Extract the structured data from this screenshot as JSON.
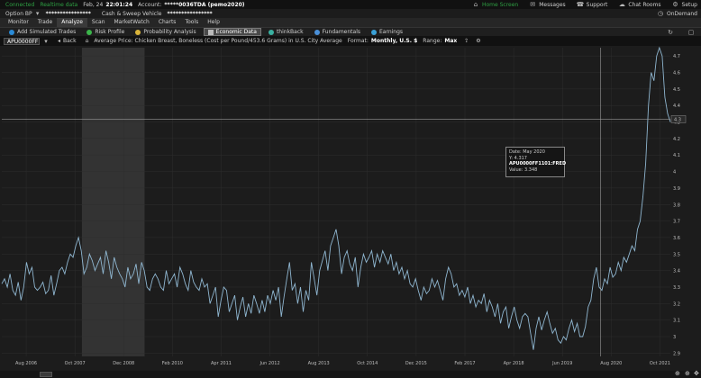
{
  "status_bar": {
    "connection": "Connected",
    "data_mode": "Realtime data",
    "date": "Feb, 24",
    "time": "22:01:24",
    "account_label": "Account:",
    "account_value": "*****0036TDA (pemo2020)",
    "right_items": [
      "Home Screen",
      "Messages",
      "Support",
      "Chat Rooms",
      "Setup"
    ]
  },
  "account_bar": {
    "option_bp_label": "Option BP",
    "option_bp_value": "****************",
    "cash_label": "Cash & Sweep Vehicle",
    "cash_value": "****************",
    "ondemand_label": "OnDemand"
  },
  "menu": {
    "items": [
      "Monitor",
      "Trade",
      "Analyze",
      "Scan",
      "MarketWatch",
      "Charts",
      "Tools",
      "Help"
    ],
    "active": "Analyze"
  },
  "toolbar": {
    "items": [
      {
        "label": "Add Simulated Trades",
        "color": "#2a8ad6"
      },
      {
        "label": "Risk Profile",
        "color": "#3bb54a"
      },
      {
        "label": "Probability Analysis",
        "color": "#d9b43a"
      },
      {
        "label": "Economic Data",
        "color": "#bbbbbb"
      },
      {
        "label": "thinkBack",
        "color": "#3ab0a0"
      },
      {
        "label": "Fundamentals",
        "color": "#4a90d9"
      },
      {
        "label": "Earnings",
        "color": "#3aa0d6"
      }
    ],
    "active": "Economic Data"
  },
  "nav": {
    "symbol": "APU0000FF1101:FRED",
    "back_label": "Back",
    "series_title": "Average Price: Chicken Breast, Boneless (Cost per Pound/453.6 Grams) in U.S. City Average",
    "format_label": "Format:",
    "format_value": "Monthly, U.S. $",
    "range_label": "Range:",
    "range_value": "Max"
  },
  "tooltip": {
    "date_label": "Date:",
    "date_value": "May 2020",
    "y_label": "Y:",
    "y_value": "4.317",
    "series": "APU0000FF1101:FRED",
    "value_label": "Value:",
    "value_value": "3.348"
  },
  "colors": {
    "line": "#8fb6d0",
    "grid": "#2e2e2e",
    "shade": "#333333",
    "crosshair": "#9a9a9a"
  },
  "chart_data": {
    "type": "line",
    "x_tick_labels": [
      "Aug 2006",
      "Oct 2007",
      "Dec 2008",
      "Feb 2010",
      "Apr 2011",
      "Jun 2012",
      "Aug 2013",
      "Oct 2014",
      "Dec 2015",
      "Feb 2017",
      "Apr 2018",
      "Jun 2019",
      "Aug 2020",
      "Oct 2021"
    ],
    "y_tick_labels": [
      "2.9",
      "3",
      "3.1",
      "3.2",
      "3.3",
      "3.4",
      "3.5",
      "3.6",
      "3.7",
      "3.8",
      "3.9",
      "4",
      "4.1",
      "4.2",
      "4.3",
      "4.4",
      "4.5",
      "4.6",
      "4.7"
    ],
    "ylim": [
      2.88,
      4.75
    ],
    "y_axis_top_label": "4.3",
    "recession_shading": [
      "Dec 2007",
      "Jun 2009"
    ],
    "crosshair": {
      "x": "May 2020",
      "y": 4.317
    },
    "start": "2006-01",
    "end": "2022-01",
    "series": [
      {
        "values": [
          3.32,
          3.35,
          3.3,
          3.38,
          3.28,
          3.25,
          3.33,
          3.22,
          3.3,
          3.45,
          3.38,
          3.42,
          3.3,
          3.28,
          3.3,
          3.33,
          3.26,
          3.28,
          3.37,
          3.25,
          3.32,
          3.4,
          3.42,
          3.38,
          3.45,
          3.5,
          3.48,
          3.55,
          3.6,
          3.52,
          3.38,
          3.42,
          3.5,
          3.46,
          3.4,
          3.44,
          3.48,
          3.38,
          3.52,
          3.45,
          3.35,
          3.48,
          3.42,
          3.38,
          3.35,
          3.3,
          3.42,
          3.35,
          3.38,
          3.44,
          3.32,
          3.45,
          3.4,
          3.3,
          3.28,
          3.35,
          3.38,
          3.35,
          3.3,
          3.28,
          3.4,
          3.32,
          3.35,
          3.38,
          3.3,
          3.42,
          3.38,
          3.32,
          3.28,
          3.4,
          3.33,
          3.3,
          3.28,
          3.35,
          3.3,
          3.32,
          3.2,
          3.25,
          3.3,
          3.12,
          3.22,
          3.3,
          3.28,
          3.15,
          3.2,
          3.25,
          3.1,
          3.18,
          3.24,
          3.12,
          3.2,
          3.14,
          3.25,
          3.2,
          3.14,
          3.22,
          3.15,
          3.25,
          3.2,
          3.28,
          3.22,
          3.3,
          3.12,
          3.24,
          3.35,
          3.45,
          3.28,
          3.32,
          3.2,
          3.3,
          3.15,
          3.28,
          3.22,
          3.45,
          3.35,
          3.25,
          3.4,
          3.46,
          3.52,
          3.4,
          3.55,
          3.6,
          3.65,
          3.55,
          3.38,
          3.48,
          3.52,
          3.44,
          3.4,
          3.48,
          3.3,
          3.42,
          3.5,
          3.45,
          3.48,
          3.52,
          3.42,
          3.5,
          3.45,
          3.52,
          3.48,
          3.44,
          3.5,
          3.4,
          3.45,
          3.38,
          3.42,
          3.35,
          3.4,
          3.32,
          3.3,
          3.35,
          3.28,
          3.22,
          3.3,
          3.26,
          3.28,
          3.35,
          3.3,
          3.34,
          3.28,
          3.22,
          3.35,
          3.42,
          3.38,
          3.3,
          3.32,
          3.25,
          3.28,
          3.24,
          3.3,
          3.2,
          3.25,
          3.18,
          3.22,
          3.2,
          3.26,
          3.15,
          3.22,
          3.18,
          3.12,
          3.2,
          3.08,
          3.15,
          3.18,
          3.05,
          3.12,
          3.18,
          3.1,
          3.05,
          3.12,
          3.14,
          3.12,
          3.02,
          2.92,
          3.05,
          3.12,
          3.04,
          3.1,
          3.15,
          3.08,
          3.02,
          3.05,
          2.98,
          2.96,
          3.0,
          2.98,
          3.05,
          3.1,
          3.03,
          3.08,
          3.0,
          3.0,
          3.06,
          3.18,
          3.22,
          3.35,
          3.42,
          3.3,
          3.28,
          3.35,
          3.32,
          3.42,
          3.36,
          3.38,
          3.45,
          3.4,
          3.48,
          3.45,
          3.5,
          3.55,
          3.52,
          3.65,
          3.7,
          3.85,
          4.05,
          4.4,
          4.6,
          4.55,
          4.7,
          4.75,
          4.7,
          4.45,
          4.35,
          4.3
        ]
      }
    ]
  }
}
